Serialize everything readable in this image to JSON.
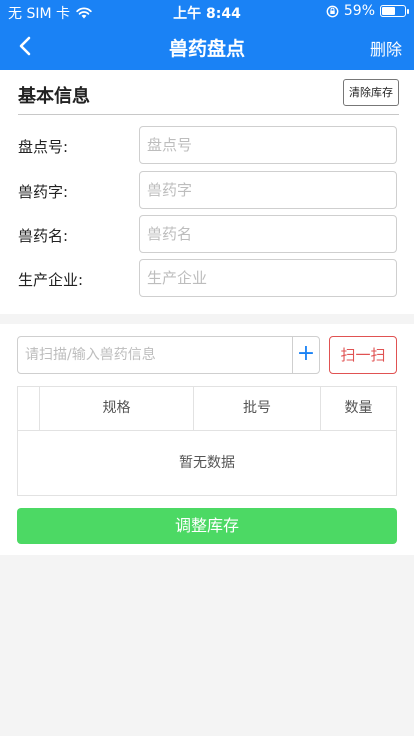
{
  "status_bar": {
    "carrier": "无 SIM 卡",
    "time": "上午 8:44",
    "battery": "59%",
    "battery_level": 0.59
  },
  "nav": {
    "title": "兽药盘点",
    "delete_label": "删除"
  },
  "basic_info": {
    "title": "基本信息",
    "clear_button": "清除库存",
    "fields": [
      {
        "label": "盘点号:",
        "placeholder": "盘点号",
        "value": ""
      },
      {
        "label": "兽药字:",
        "placeholder": "兽药字",
        "value": ""
      },
      {
        "label": "兽药名:",
        "placeholder": "兽药名",
        "value": ""
      },
      {
        "label": "生产企业:",
        "placeholder": "生产企业",
        "value": ""
      }
    ]
  },
  "scan": {
    "placeholder": "请扫描/输入兽药信息",
    "plus_label": "+",
    "scan_button": "扫一扫"
  },
  "table": {
    "columns": [
      "",
      "规格",
      "批号",
      "数量"
    ],
    "empty_text": "暂无数据"
  },
  "adjust_button": "调整库存",
  "colors": {
    "primary": "#1a82f5",
    "danger": "#e05252",
    "success": "#4cd964"
  }
}
